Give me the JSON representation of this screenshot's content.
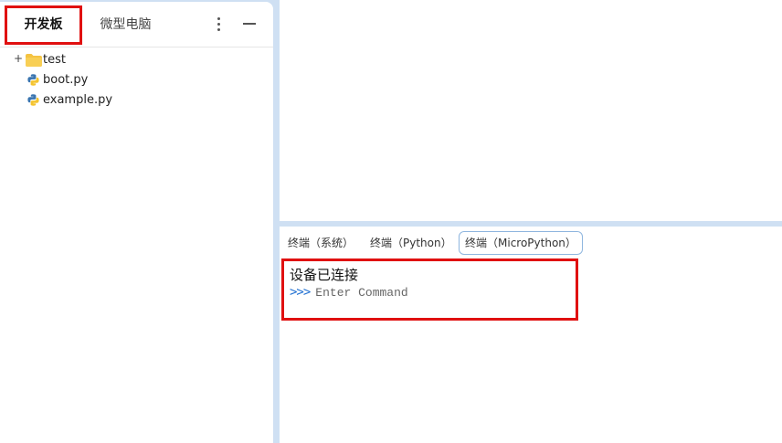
{
  "sidebar": {
    "tabs": [
      {
        "label": "开发板"
      },
      {
        "label": "微型电脑"
      }
    ],
    "tree": [
      {
        "label": "test",
        "type": "folder",
        "expander": "+"
      },
      {
        "label": "boot.py",
        "type": "python-file"
      },
      {
        "label": "example.py",
        "type": "python-file"
      }
    ]
  },
  "terminal": {
    "tabs": [
      {
        "label": "终端（系统）"
      },
      {
        "label": "终端（Python）"
      },
      {
        "label": "终端（MicroPython）"
      }
    ],
    "status_line": "设备已连接",
    "prompt": ">>>",
    "input_placeholder": "Enter Command"
  },
  "colors": {
    "accent": "#1f6fd1",
    "highlight": "#e01010",
    "background": "#cfe0f3",
    "folder": "#f5c342"
  }
}
